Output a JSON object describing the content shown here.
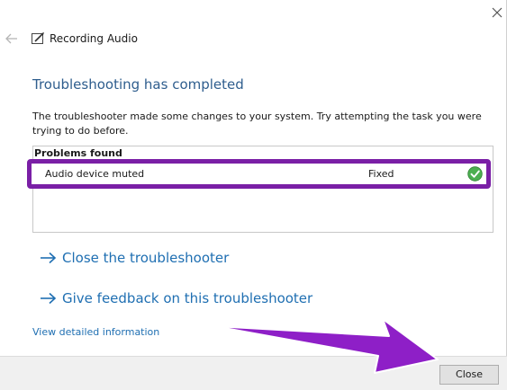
{
  "window": {
    "title": "Recording Audio"
  },
  "main": {
    "heading": "Troubleshooting has completed",
    "description": "The troubleshooter made some changes to your system. Try attempting the task you were trying to do before.",
    "problems": {
      "header": "Problems found",
      "items": [
        {
          "name": "Audio device muted",
          "status": "Fixed"
        }
      ]
    },
    "links": {
      "close_troubleshooter": "Close the troubleshooter",
      "give_feedback": "Give feedback on this troubleshooter",
      "view_details": "View detailed information"
    }
  },
  "footer": {
    "close_label": "Close"
  },
  "colors": {
    "heading": "#2f5e8e",
    "link": "#1f6fb2",
    "highlight": "#7a1fa6",
    "fixed_check": "#4caf50"
  }
}
